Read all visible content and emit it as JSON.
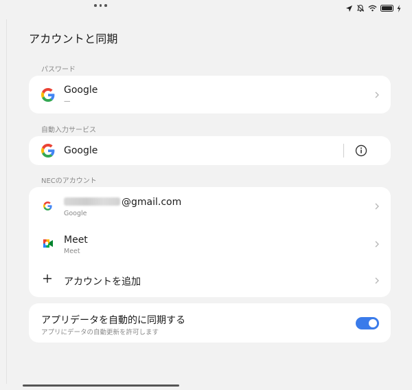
{
  "status_bar": {
    "icons": [
      "location-arrow-icon",
      "do-not-disturb-icon",
      "wifi-icon",
      "battery-icon",
      "charging-icon"
    ]
  },
  "page": {
    "title": "アカウントと同期"
  },
  "password_section": {
    "label": "パスワード",
    "item": {
      "title": "Google",
      "subtitle": "—",
      "icon": "google-g-icon"
    }
  },
  "autofill_section": {
    "label": "自動入力サービス",
    "item": {
      "title": "Google",
      "icon": "google-g-icon",
      "action_icon": "info-icon"
    }
  },
  "accounts_section": {
    "label": "NECのアカウント",
    "items": [
      {
        "title_suffix": "@gmail.com",
        "subtitle": "Google",
        "icon": "google-g-icon"
      },
      {
        "title": "Meet",
        "subtitle": "Meet",
        "icon": "google-meet-icon"
      }
    ],
    "add_label": "アカウントを追加"
  },
  "sync": {
    "title": "アプリデータを自動的に同期する",
    "subtitle": "アプリにデータの自動更新を許可します",
    "enabled": true,
    "accent": "#3a7bea"
  }
}
